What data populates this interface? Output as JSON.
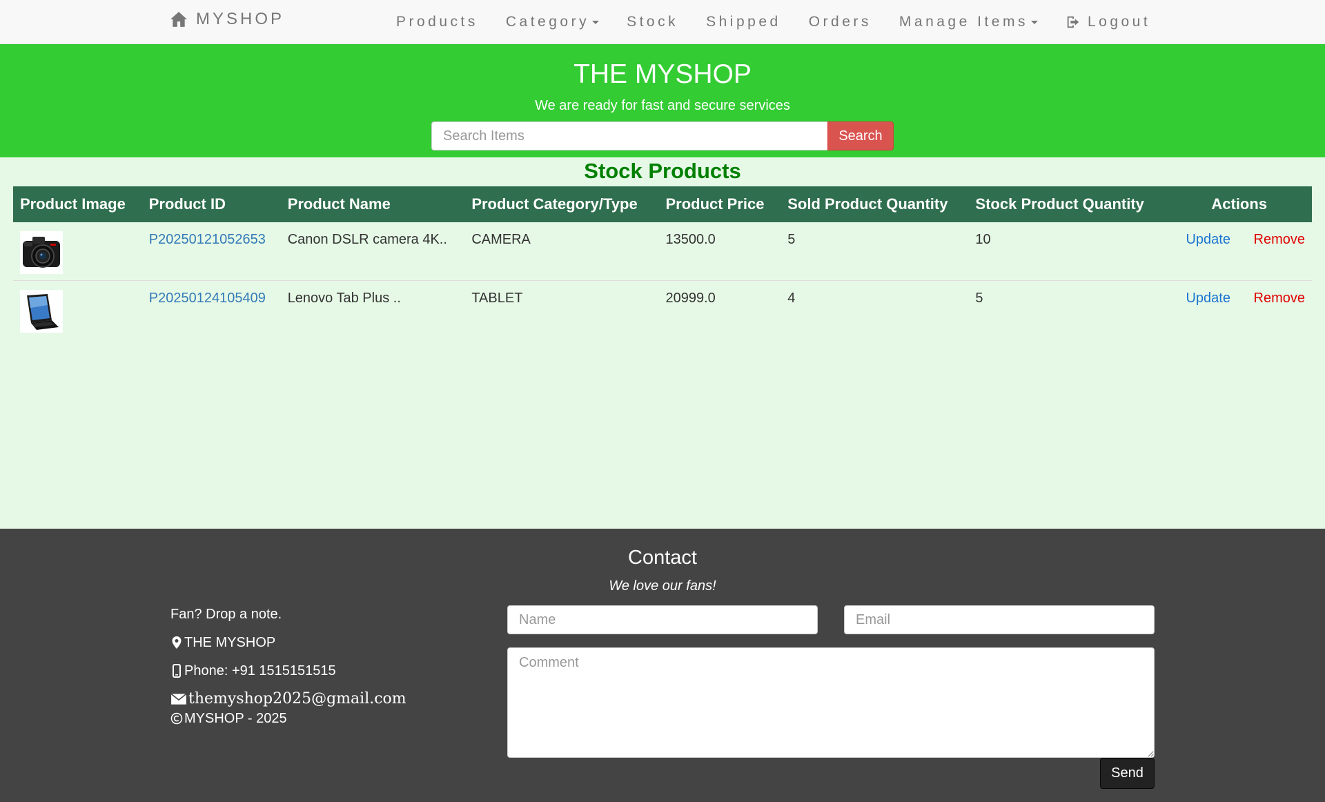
{
  "navbar": {
    "brand": "MYSHOP",
    "items": [
      {
        "label": "Products",
        "dropdown": false
      },
      {
        "label": "Category",
        "dropdown": true
      },
      {
        "label": "Stock",
        "dropdown": false
      },
      {
        "label": "Shipped",
        "dropdown": false
      },
      {
        "label": "Orders",
        "dropdown": false
      },
      {
        "label": "Manage Items",
        "dropdown": true
      }
    ],
    "logout": "Logout"
  },
  "header": {
    "title": "THE MYSHOP",
    "tagline": "We are ready for fast and secure services",
    "search_placeholder": "Search Items",
    "search_button": "Search",
    "bg_color": "#33cc33"
  },
  "main": {
    "title": "Stock Products",
    "columns": [
      "Product Image",
      "Product ID",
      "Product Name",
      "Product Category/Type",
      "Product Price",
      "Sold Product Quantity",
      "Stock Product Quantity",
      "Actions"
    ],
    "rows": [
      {
        "image": "camera-image",
        "id": "P20250121052653",
        "name": "Canon DSLR camera 4K..",
        "category": "CAMERA",
        "price": "13500.0",
        "sold": "5",
        "stock": "10",
        "update": "Update",
        "remove": "Remove"
      },
      {
        "image": "tablet-image",
        "id": "P20250124105409",
        "name": "Lenovo Tab Plus ..",
        "category": "TABLET",
        "price": "20999.0",
        "sold": "4",
        "stock": "5",
        "update": "Update",
        "remove": "Remove"
      }
    ]
  },
  "footer": {
    "title": "Contact",
    "subtitle": "We love our fans!",
    "note": "Fan? Drop a note.",
    "address": "THE MYSHOP",
    "phone": "Phone: +91 1515151515",
    "email": "themyshop2025@gmail.com",
    "copyright": "MYSHOP - 2025",
    "name_placeholder": "Name",
    "email_placeholder": "Email",
    "comment_placeholder": "Comment",
    "send_button": "Send"
  },
  "icons": {
    "brand": "home-icon",
    "logout": "logout-icon",
    "address": "map-marker-icon",
    "phone": "phone-icon",
    "email": "envelope-icon",
    "copyright": "copyright-icon"
  }
}
